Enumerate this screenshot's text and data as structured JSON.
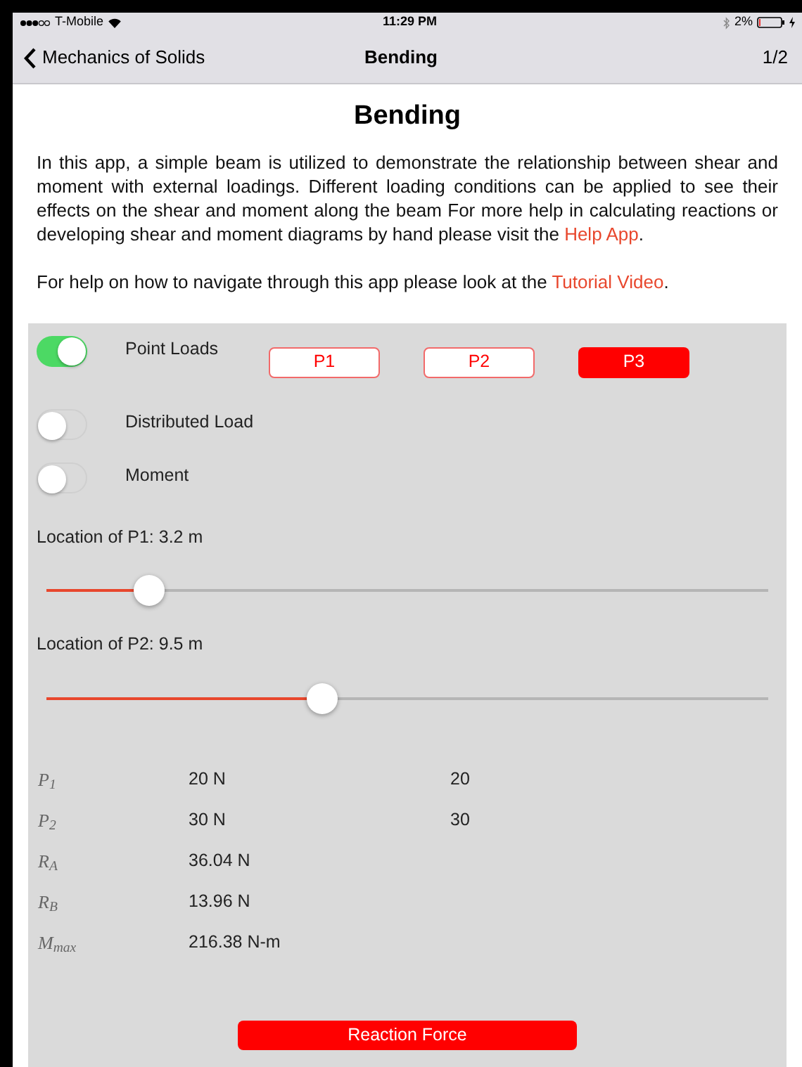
{
  "status_bar": {
    "carrier": "T-Mobile",
    "time": "11:29 PM",
    "battery": "2%"
  },
  "nav": {
    "back": "Mechanics of Solids",
    "title": "Bending",
    "page": "1/2"
  },
  "heading": "Bending",
  "paragraphs": [
    {
      "text": "In this app, a simple beam is utilized to demonstrate the relationship between shear and moment with external loadings. Different loading conditions can be applied to see their effects on the shear and moment along the beam For more help in calculating reactions or developing shear and moment diagrams by hand please visit the ",
      "link": "Help App",
      "end": "."
    },
    {
      "text": "For help on how to navigate through this app please look at the ",
      "link": "Tutorial Video",
      "end": "."
    }
  ],
  "toggles": [
    {
      "label": "Point Loads",
      "on": true
    },
    {
      "label": "Distributed Load",
      "on": false
    },
    {
      "label": "Moment",
      "on": false
    }
  ],
  "load_buttons": [
    {
      "label": "P1",
      "selected": false
    },
    {
      "label": "P2",
      "selected": false
    },
    {
      "label": "P3",
      "selected": true
    }
  ],
  "sliders": [
    {
      "label": "Location of P1: 3.2 m",
      "level": 0.143
    },
    {
      "label": "Location of P2: 9.5 m",
      "level": 0.383
    }
  ],
  "results": [
    {
      "symbol": "P$_{1}$",
      "value": "20 N",
      "column_3": "20"
    },
    {
      "symbol": "P$_{2}$",
      "value": "30 N",
      "column_3": "30"
    },
    {
      "symbol": "R$_{A}$",
      "value": "36.04 N"
    },
    {
      "symbol": "R$_{B}$",
      "value": "13.96 N"
    },
    {
      "symbol": "M$_{max}$",
      "value": "216.38 N-m"
    }
  ],
  "action_button": "Reaction Force"
}
